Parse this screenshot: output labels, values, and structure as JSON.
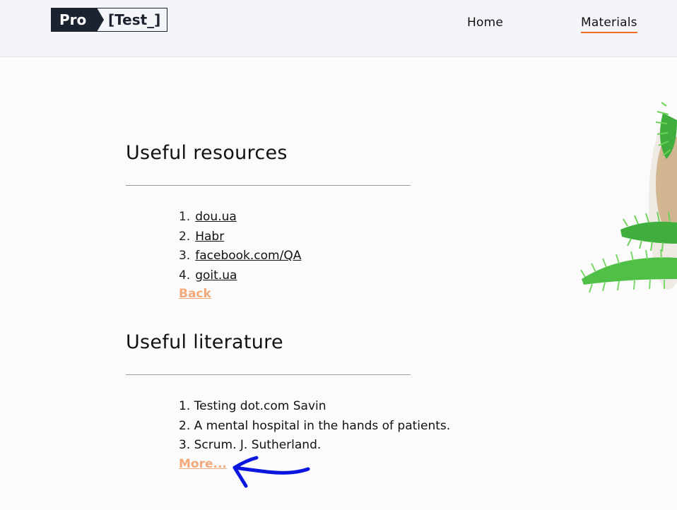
{
  "header": {
    "logo": {
      "left": "Pro",
      "right": "[Test_]"
    },
    "nav": [
      {
        "label": "Home",
        "active": false
      },
      {
        "label": "Materials",
        "active": true
      }
    ],
    "accent_color": "#f26b21"
  },
  "resources": {
    "title": "Useful resources",
    "items": [
      {
        "number": "1.",
        "label": "dou.ua"
      },
      {
        "number": "2.",
        "label": "Habr"
      },
      {
        "number": "3.",
        "label": "facebook.com/QA"
      },
      {
        "number": "4.",
        "label": "goit.ua"
      }
    ],
    "action_label": "Back"
  },
  "literature": {
    "title": "Useful literature",
    "items": [
      {
        "text": "1. Testing dot.com Savin"
      },
      {
        "text": "2. A mental hospital in the hands of patients."
      },
      {
        "text": "3. Scrum. J. Sutherland."
      }
    ],
    "action_label": "More..."
  },
  "link_color": "#f3a97a",
  "annotation_color": "#0a16e0"
}
